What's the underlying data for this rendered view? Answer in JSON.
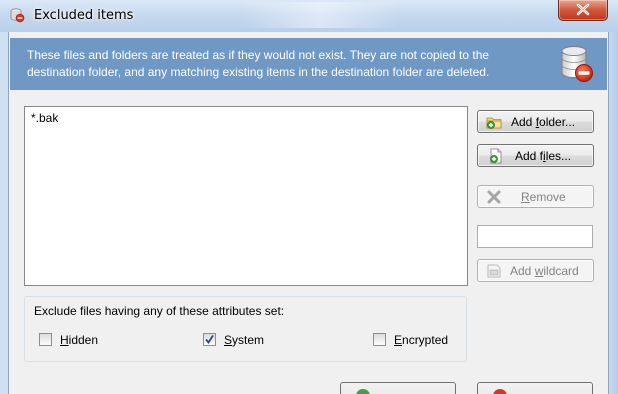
{
  "window": {
    "title": "Excluded items"
  },
  "banner": {
    "line1": "These files and folders are treated as if they would not exist. They are not copied to the",
    "line2": "destination folder, and any matching existing items in the destination folder are deleted.",
    "icon": "database-delete-icon"
  },
  "excluded_list": {
    "items": [
      "*.bak"
    ]
  },
  "buttons": {
    "add_folder": {
      "pre": "Add ",
      "key": "f",
      "post": "older...",
      "icon": "add-folder-icon",
      "enabled": true
    },
    "add_files": {
      "pre": "Add f",
      "key": "i",
      "post": "les...",
      "icon": "add-file-icon",
      "enabled": true
    },
    "remove": {
      "pre": "",
      "key": "R",
      "post": "emove",
      "icon": "remove-x-icon",
      "enabled": false
    },
    "add_wildcard": {
      "pre": "Add ",
      "key": "w",
      "post": "ildcard",
      "icon": "wildcard-icon",
      "enabled": false
    }
  },
  "wildcard_input": {
    "value": ""
  },
  "attributes": {
    "group_label": "Exclude files having any of these attributes set:",
    "options": [
      {
        "key": "H",
        "rest": "idden",
        "checked": false
      },
      {
        "key": "S",
        "rest": "ystem",
        "checked": true
      },
      {
        "key": "E",
        "rest": "ncrypted",
        "checked": false
      }
    ]
  },
  "colors": {
    "banner": "#6f98c4",
    "close_button": "#c73f22"
  }
}
